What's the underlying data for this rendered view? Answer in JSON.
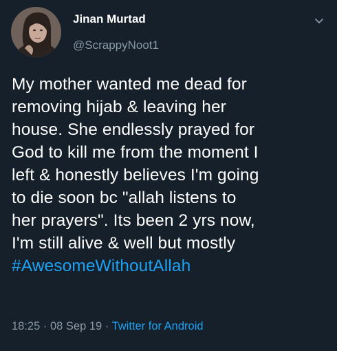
{
  "tweet": {
    "display_name": "Jinan Murtad",
    "handle": "@ScrappyNoot1",
    "text": "My mother wanted me dead for\nremoving hijab & leaving her\nhouse. She endlessly prayed for\nGod to kill me from the moment I\nleft & honestly believes I'm going\nto die soon bc \"allah listens to\nher prayers\". Its been 2 yrs now,\nI'm still alive & well but mostly\n",
    "hashtag": "#AwesomeWithoutAllah",
    "time": "18:25",
    "separator1": " · ",
    "date": "08 Sep 19",
    "separator2": " · ",
    "source": "Twitter for Android"
  },
  "icons": {
    "menu": "chevron-down-icon"
  },
  "colors": {
    "background": "#15202b",
    "text": "#ffffff",
    "muted": "#8899a6",
    "accent": "#1da1f2"
  }
}
